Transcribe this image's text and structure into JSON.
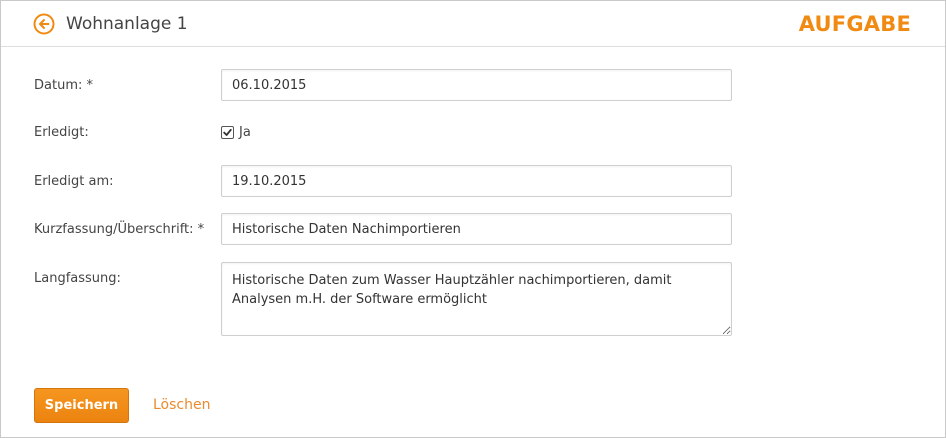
{
  "header": {
    "title": "Wohnanlage 1",
    "badge": "AUFGABE",
    "back_icon": "arrow-left-circle-icon"
  },
  "colors": {
    "accent": "#f08a12",
    "link": "#e98b2e"
  },
  "form": {
    "date": {
      "label": "Datum: *",
      "value": "06.10.2015"
    },
    "done": {
      "label": "Erledigt:",
      "checkbox_label": "Ja",
      "checked": true
    },
    "done_at": {
      "label": "Erledigt am:",
      "value": "19.10.2015"
    },
    "summary": {
      "label": "Kurzfassung/Überschrift: *",
      "value": "Historische Daten Nachimportieren"
    },
    "description": {
      "label": "Langfassung:",
      "value": "Historische Daten zum Wasser Hauptzähler nachimportieren, damit Analysen m.H. der Software ermöglicht"
    }
  },
  "actions": {
    "save_label": "Speichern",
    "delete_label": "Löschen"
  }
}
